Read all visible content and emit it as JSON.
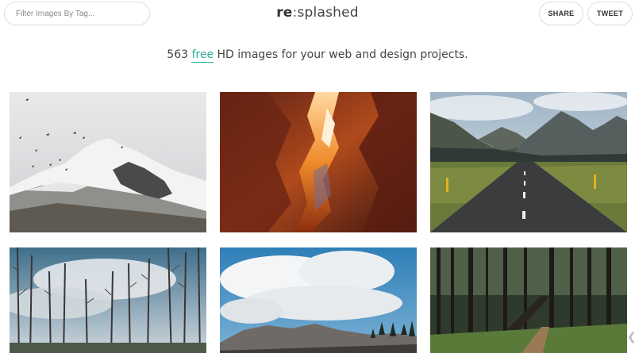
{
  "header": {
    "search_placeholder": "Filter Images By Tag...",
    "logo_bold": "re",
    "logo_sep": ":",
    "logo_rest": "splashed",
    "share_label": "SHARE",
    "tweet_label": "TWEET"
  },
  "tagline": {
    "before": "563 ",
    "free": "free",
    "after": " HD images for your web and design projects."
  },
  "colors": {
    "accent": "#2bb09a"
  },
  "icons": {
    "scroll_arrow": "chevron-left-icon"
  }
}
